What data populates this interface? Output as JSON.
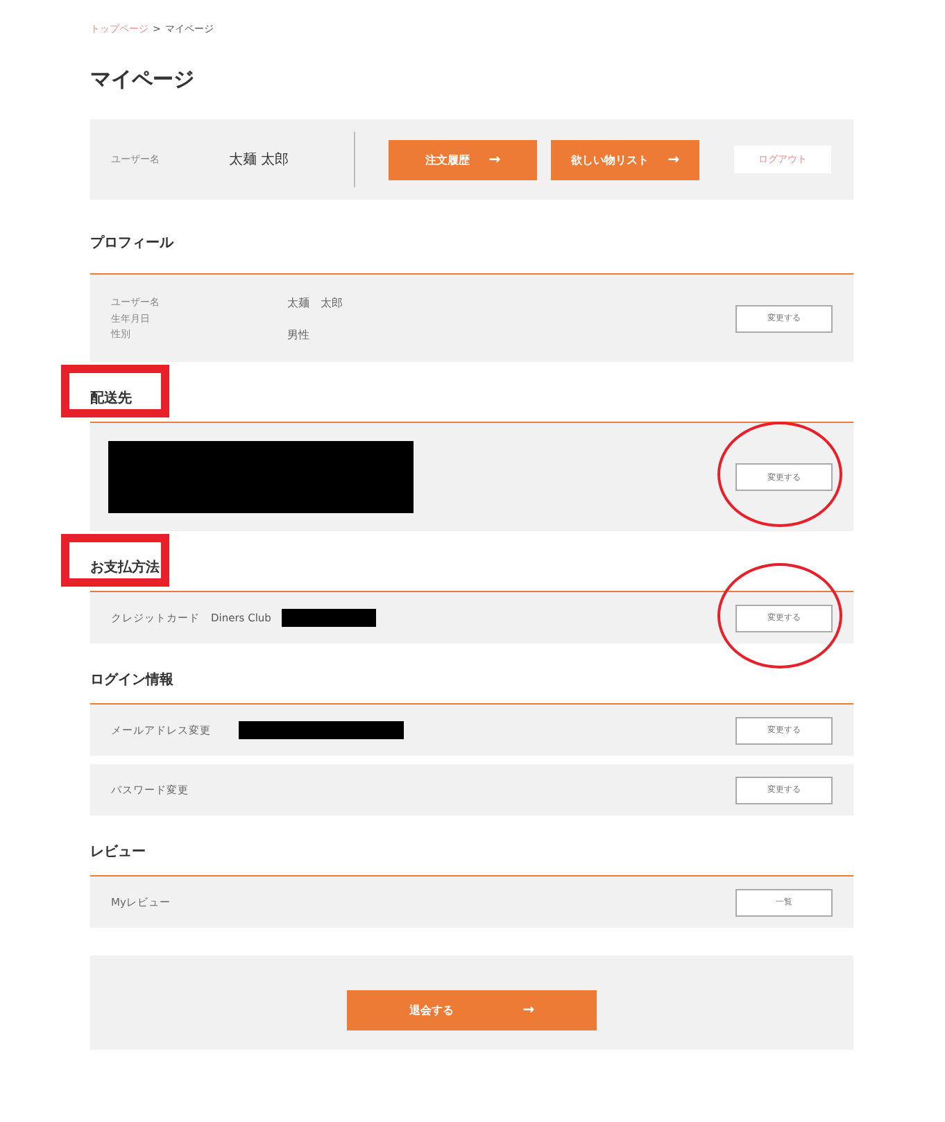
{
  "breadcrumb": [
    {
      "label": "トップページ",
      "link": true
    },
    {
      "label": "マイページ",
      "link": false
    }
  ],
  "breadcrumb_separator": ">",
  "title": "マイページ",
  "account": {
    "label": "ユーザー名",
    "value": "太麺 太郎",
    "buttons": [
      {
        "label": "注文履歴",
        "arrow": "→"
      },
      {
        "label": "欲しい物リスト",
        "arrow": "→"
      }
    ],
    "logout": "ログアウト"
  },
  "sections": [
    {
      "heading": "プロフィール",
      "highlighted": false,
      "rows": [
        {
          "kind": "profile",
          "fields": [
            {
              "label": "ユーザー名",
              "value": "太麺　太郎"
            },
            {
              "label": "生年月日"
            },
            {
              "label": "性別",
              "value": "男性"
            }
          ],
          "button": "変更する",
          "circled": false
        }
      ]
    },
    {
      "heading": "配送先",
      "highlighted": true,
      "rows": [
        {
          "kind": "redacted",
          "button": "変更する",
          "circled": true
        }
      ]
    },
    {
      "heading": "お支払方法",
      "highlighted": true,
      "rows": [
        {
          "kind": "field",
          "label": "クレジットカード",
          "value": "Diners Club",
          "redacted": true,
          "button": "変更する",
          "circled": true
        }
      ]
    },
    {
      "heading": "ログイン情報",
      "highlighted": false,
      "rows": [
        {
          "kind": "field",
          "label": "メールアドレス変更",
          "redacted": true,
          "button": "変更する",
          "circled": false
        },
        {
          "kind": "field",
          "label": "パスワード変更",
          "redacted": false,
          "button": "変更する",
          "circled": false
        }
      ]
    },
    {
      "heading": "レビュー",
      "highlighted": false,
      "rows": [
        {
          "kind": "field",
          "label": "Myレビュー",
          "redacted": false,
          "button": "一覧",
          "circled": false
        }
      ]
    }
  ],
  "withdraw": {
    "label": "退会する",
    "arrow": "→"
  }
}
